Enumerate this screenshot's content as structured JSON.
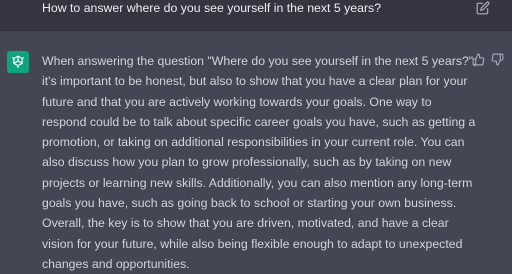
{
  "user_message": {
    "text": "How to answer where do you see yourself in the next 5 years?",
    "edit_icon": "edit-icon"
  },
  "assistant_message": {
    "avatar_icon": "chatgpt-logo-icon",
    "text": "When answering the question \"Where do you see yourself in the next 5 years?\", it's important to be honest, but also to show that you have a clear plan for your future and that you are actively working towards your goals. One way to respond could be to talk about specific career goals you have, such as getting a promotion, or taking on additional responsibilities in your current role. You can also discuss how you plan to grow professionally, such as by taking on new projects or learning new skills. Additionally, you can also mention any long-term goals you have, such as going back to school or starting your own business. Overall, the key is to show that you are driven, motivated, and have a clear vision for your future, while also being flexible enough to adapt to unexpected changes and opportunities.",
    "feedback_icons": [
      "thumbs-up-icon",
      "thumbs-down-icon"
    ]
  },
  "colors": {
    "user_bg": "#343541",
    "assistant_bg": "#444654",
    "avatar_bg": "#10a37f",
    "text": "#d1d5db"
  }
}
